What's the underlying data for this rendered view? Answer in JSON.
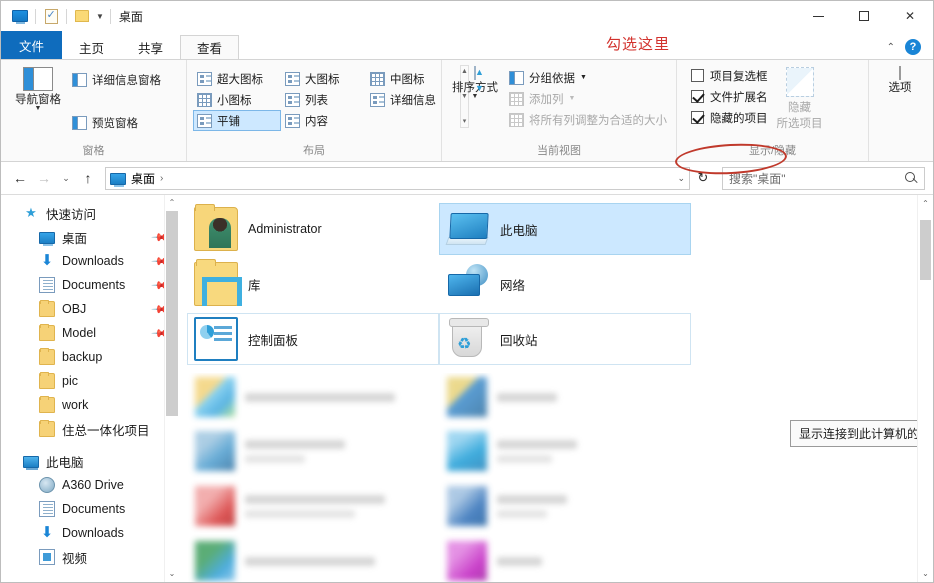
{
  "window": {
    "title": "桌面",
    "quick_access_icons": [
      "monitor-icon",
      "properties-icon",
      "new-folder-icon"
    ],
    "controls": {
      "minimize": "—",
      "maximize": "□",
      "close": "✕"
    }
  },
  "tabs": [
    {
      "label": "文件",
      "state": "file-menu"
    },
    {
      "label": "主页",
      "state": "normal"
    },
    {
      "label": "共享",
      "state": "normal"
    },
    {
      "label": "查看",
      "state": "active"
    }
  ],
  "annotation": {
    "text": "勾选这里",
    "color": "#d2322d"
  },
  "tabstrip_right": {
    "collapse": "⌃",
    "help": "?"
  },
  "ribbon": {
    "groups": [
      {
        "label": "窗格",
        "big_button": {
          "caption": "导航窗格",
          "icon": "nav-pane-icon"
        },
        "items": [
          {
            "label": "详细信息窗格",
            "icon": "details-pane-icon",
            "enabled": true
          },
          {
            "label": "预览窗格",
            "icon": "preview-pane-icon",
            "enabled": true
          }
        ]
      },
      {
        "label": "布局",
        "views": [
          {
            "label": "超大图标",
            "selected": false
          },
          {
            "label": "大图标",
            "selected": false
          },
          {
            "label": "中图标",
            "selected": false
          },
          {
            "label": "小图标",
            "selected": false
          },
          {
            "label": "列表",
            "selected": false
          },
          {
            "label": "详细信息",
            "selected": false
          },
          {
            "label": "平铺",
            "selected": true
          },
          {
            "label": "内容",
            "selected": false
          }
        ],
        "scroll": {
          "up": "▲",
          "down": "▼",
          "more": "▾"
        }
      },
      {
        "label": "当前视图",
        "big_button": {
          "caption": "排序方式",
          "icon": "sort-icon",
          "has_dropdown": true
        },
        "items": [
          {
            "label": "分组依据",
            "icon": "group-by-icon",
            "enabled": true,
            "has_dropdown": true
          },
          {
            "label": "添加列",
            "icon": "add-column-icon",
            "enabled": false,
            "has_dropdown": true
          },
          {
            "label": "将所有列调整为合适的大小",
            "icon": "fit-columns-icon",
            "enabled": false
          }
        ]
      },
      {
        "label": "显示/隐藏",
        "checkboxes": [
          {
            "label": "项目复选框",
            "checked": false
          },
          {
            "label": "文件扩展名",
            "checked": true,
            "highlighted": true
          },
          {
            "label": "隐藏的项目",
            "checked": true
          }
        ],
        "hide_button": {
          "line1": "隐藏",
          "line2": "所选项目",
          "enabled": false
        }
      },
      {
        "label": "",
        "options_button": {
          "caption": "选项",
          "icon": "options-icon"
        }
      }
    ]
  },
  "addressbar": {
    "back": "←",
    "forward": "→",
    "recent": "⌄",
    "up": "↑",
    "path_icon": "desktop-icon",
    "path_label": "桌面",
    "path_separator": "›",
    "dropdown": "⌄",
    "refresh": "↻",
    "search_placeholder": "搜索\"桌面\""
  },
  "sidebar": {
    "items": [
      {
        "label": "快速访问",
        "icon": "pin-star-icon",
        "level": "root",
        "pinned": false
      },
      {
        "label": "桌面",
        "icon": "desktop-icon",
        "level": "child",
        "pinned": true
      },
      {
        "label": "Downloads",
        "icon": "download-icon",
        "level": "child",
        "pinned": true
      },
      {
        "label": "Documents",
        "icon": "document-icon",
        "level": "child",
        "pinned": true
      },
      {
        "label": "OBJ",
        "icon": "folder-icon",
        "level": "child",
        "pinned": true
      },
      {
        "label": "Model",
        "icon": "folder-icon",
        "level": "child",
        "pinned": true
      },
      {
        "label": "backup",
        "icon": "folder-icon",
        "level": "child",
        "pinned": false
      },
      {
        "label": "pic",
        "icon": "folder-icon",
        "level": "child",
        "pinned": false
      },
      {
        "label": "work",
        "icon": "folder-icon",
        "level": "child",
        "pinned": false
      },
      {
        "label": "住总一体化项目",
        "icon": "folder-icon",
        "level": "child",
        "pinned": false
      },
      {
        "label": "此电脑",
        "icon": "pc-icon",
        "level": "root",
        "pinned": false
      },
      {
        "label": "A360 Drive",
        "icon": "a360-icon",
        "level": "child",
        "pinned": false
      },
      {
        "label": "Documents",
        "icon": "document-icon",
        "level": "child",
        "pinned": false
      },
      {
        "label": "Downloads",
        "icon": "download-icon",
        "level": "child",
        "pinned": false
      },
      {
        "label": "视频",
        "icon": "video-icon",
        "level": "child",
        "pinned": false
      }
    ],
    "scroll": {
      "up": "⌃",
      "down": "⌄"
    }
  },
  "content": {
    "tiles": [
      {
        "label": "Administrator",
        "icon": "user-folder-icon",
        "selected": false,
        "outlined": false,
        "col": 1,
        "row": 1
      },
      {
        "label": "此电脑",
        "icon": "this-pc-icon",
        "selected": true,
        "outlined": false,
        "col": 2,
        "row": 1
      },
      {
        "label": "库",
        "icon": "library-icon",
        "selected": false,
        "outlined": false,
        "col": 1,
        "row": 2
      },
      {
        "label": "网络",
        "icon": "network-icon",
        "selected": false,
        "outlined": false,
        "col": 2,
        "row": 2
      },
      {
        "label": "控制面板",
        "icon": "control-panel-icon",
        "selected": false,
        "outlined": true,
        "col": 1,
        "row": 3
      },
      {
        "label": "回收站",
        "icon": "recycle-bin-icon",
        "selected": false,
        "outlined": true,
        "col": 2,
        "row": 3
      }
    ],
    "tooltip": "显示连接到此计算机的驱动器和硬件。",
    "scroll": {
      "up": "⌃",
      "down": "⌄"
    }
  }
}
